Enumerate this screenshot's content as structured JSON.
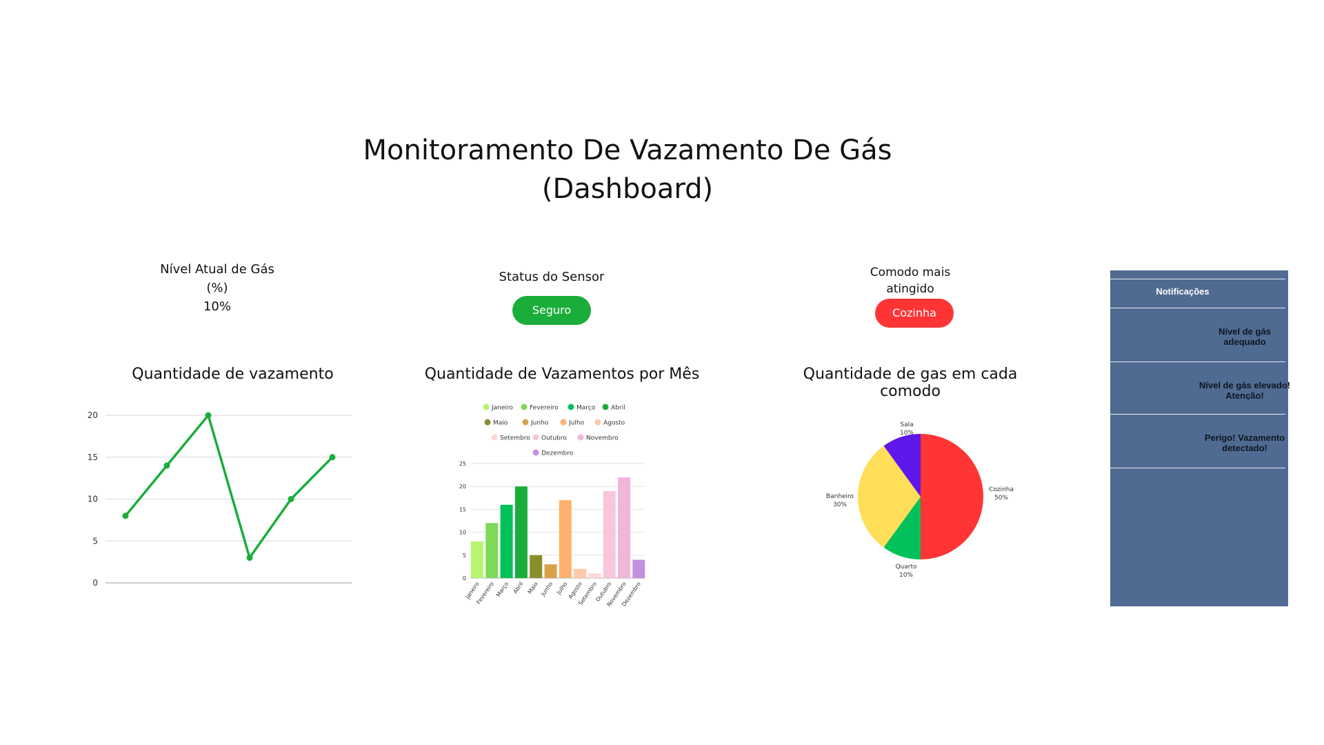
{
  "page": {
    "title_line1": "Monitoramento De Vazamento De Gás",
    "title_line2": "(Dashboard)"
  },
  "kpis": {
    "gas_level": {
      "label_line1": "Nível Atual de Gás",
      "label_line2": "(%)",
      "value": "10%"
    },
    "sensor_status": {
      "label": "Status do Sensor",
      "value": "Seguro",
      "color": "#1aad3a"
    },
    "most_affected_room": {
      "label_line1": "Comodo mais",
      "label_line2": "atingido",
      "value": "Cozinha",
      "color": "#ff3434"
    }
  },
  "notifications": {
    "header": "Notificações",
    "items": [
      {
        "line1": "Nível de gás",
        "line2": "adequado"
      },
      {
        "line1": "Nível de gás elevado!",
        "line2": "Atenção!"
      },
      {
        "line1": "Perigo! Vazamento",
        "line2": "detectado!"
      }
    ]
  },
  "chart_data": [
    {
      "type": "line",
      "title": "Quantidade de vazamento",
      "x": [
        1,
        2,
        3,
        4,
        5,
        6
      ],
      "series": [
        {
          "values": [
            8,
            14,
            20,
            3,
            10,
            15
          ],
          "color": "#1aad3a"
        }
      ],
      "yticks": [
        0,
        5,
        10,
        15,
        20
      ],
      "ylim": [
        0,
        20
      ],
      "grid": true
    },
    {
      "type": "bar",
      "title": "Quantidade de Vazamentos por Mês",
      "categories": [
        "Janeiro",
        "Fevereiro",
        "Março",
        "Abril",
        "Maio",
        "Junho",
        "Julho",
        "Agosto",
        "Setembro",
        "Outubro",
        "Novembro",
        "Dezembro"
      ],
      "values": [
        8,
        12,
        16,
        20,
        5,
        3,
        17,
        2,
        1,
        19,
        22,
        4
      ],
      "colors": [
        "#b8f56e",
        "#7ed957",
        "#00c15a",
        "#1aad3a",
        "#8a8f2e",
        "#d9a24a",
        "#ffb06e",
        "#ffc8a8",
        "#ffd6d6",
        "#f8c6da",
        "#f0b6da",
        "#c38fe0"
      ],
      "yticks": [
        0,
        5,
        10,
        15,
        20,
        25
      ],
      "ylim": [
        0,
        25
      ],
      "legend": "top",
      "grid": true
    },
    {
      "type": "pie",
      "title": "Quantidade de gas em cada comodo",
      "labels": [
        "Cozinha",
        "Quarto",
        "Banheiro",
        "Sala"
      ],
      "values": [
        50,
        10,
        30,
        10
      ],
      "percent_labels": [
        "50%",
        "10%",
        "30%",
        "10%"
      ],
      "colors": [
        "#ff3434",
        "#00c15a",
        "#ffde59",
        "#5e17eb"
      ]
    }
  ]
}
